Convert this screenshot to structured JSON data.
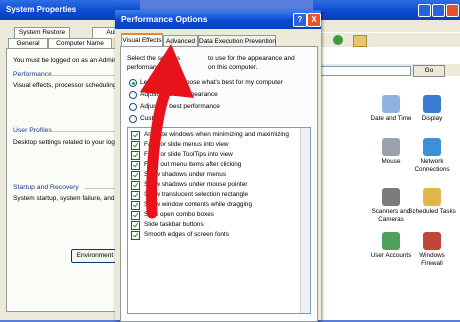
{
  "system_properties": {
    "title": "System Properties",
    "tabs_row1": [
      "System Restore",
      "Auto"
    ],
    "tabs_row2": [
      "General",
      "Computer Name"
    ],
    "intro": "You must be logged on as an Administ",
    "performance": {
      "heading": "Performance",
      "desc": "Visual effects, processor scheduling"
    },
    "user_profiles": {
      "heading": "User Profiles",
      "desc": "Desktop settings related to your logo"
    },
    "startup": {
      "heading": "Startup and Recovery",
      "desc": "System startup, system failure, and de"
    },
    "env_button": "Environment V"
  },
  "control_panel": {
    "go_label": "Go",
    "items": [
      {
        "label": "Date and Time",
        "icon": "date-time-icon",
        "color": "#8fb3e0"
      },
      {
        "label": "Display",
        "icon": "display-icon",
        "color": "#3a7bd5"
      },
      {
        "label": "Mouse",
        "icon": "mouse-icon",
        "color": "#9aa3ad"
      },
      {
        "label": "Network Connections",
        "icon": "network-connections-icon",
        "color": "#3d8fd8"
      },
      {
        "label": "Scanners and Cameras",
        "icon": "scanners-cameras-icon",
        "color": "#7c7c7c"
      },
      {
        "label": "Scheduled Tasks",
        "icon": "scheduled-tasks-icon",
        "color": "#e0b64a"
      },
      {
        "label": "User Accounts",
        "icon": "user-accounts-icon",
        "color": "#4fa05a"
      },
      {
        "label": "Windows Firewall",
        "icon": "windows-firewall-icon",
        "color": "#c0463a"
      }
    ]
  },
  "performance_options": {
    "title": "Performance Options",
    "tabs": [
      "Visual Effects",
      "Advanced",
      "Data Execution Prevention"
    ],
    "intro_line1": "Select the settings",
    "intro_line1b": "to use for the appearance and",
    "intro_line2": "performance",
    "intro_line2b": "on this computer.",
    "radios": [
      {
        "label": "Let Windows choose what's best for my computer",
        "selected": true
      },
      {
        "label": "Adjust for best appearance",
        "selected": false
      },
      {
        "label": "Adjust for best performance",
        "selected": false
      },
      {
        "label": "Custom:",
        "selected": false
      }
    ],
    "effects": [
      "Animate windows when minimizing and maximizing",
      "Fade or slide menus into view",
      "Fade or slide ToolTips into view",
      "Fade out menu items after clicking",
      "Show shadows under menus",
      "Show shadows under mouse pointer",
      "Show translucent selection rectangle",
      "Show window contents while dragging",
      "Slide open combo boxes",
      "Slide taskbar buttons",
      "Smooth edges of screen fonts"
    ],
    "help_label": "?",
    "close_label": "X"
  },
  "colors": {
    "arrow": "#e8121a",
    "titlebar": "#0a49d1",
    "dialog_bg": "#ece9d8"
  }
}
